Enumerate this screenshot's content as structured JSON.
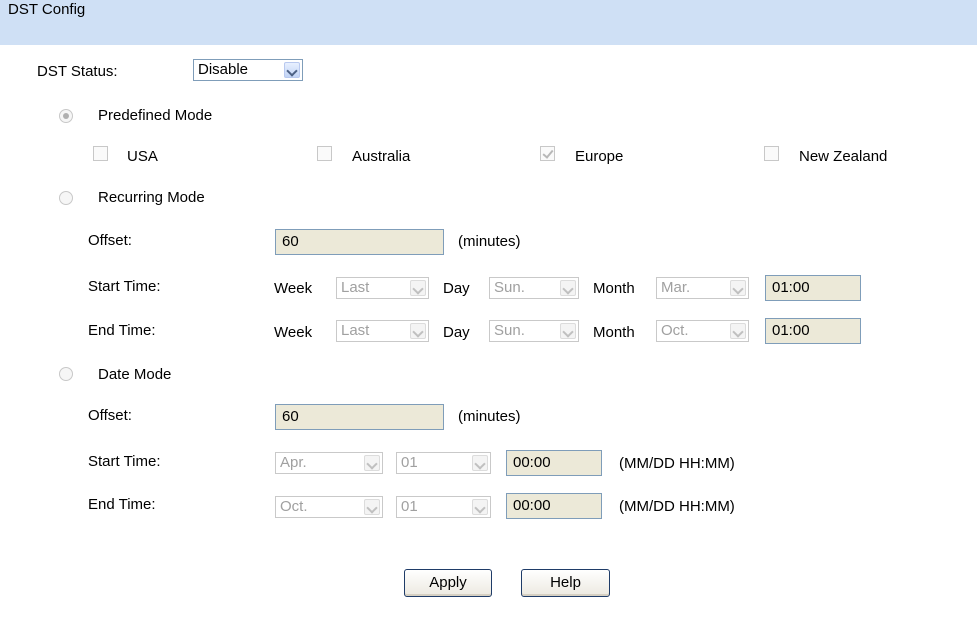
{
  "header": {
    "title": "DST Config"
  },
  "dst_status": {
    "label": "DST Status:",
    "value": "Disable"
  },
  "predefined": {
    "label": "Predefined Mode",
    "selected": true,
    "regions": [
      {
        "label": "USA",
        "checked": false
      },
      {
        "label": "Australia",
        "checked": false
      },
      {
        "label": "Europe",
        "checked": true
      },
      {
        "label": "New Zealand",
        "checked": false
      }
    ]
  },
  "recurring": {
    "label": "Recurring Mode",
    "offset_label": "Offset:",
    "offset_value": "60",
    "offset_unit": "(minutes)",
    "start_label": "Start Time:",
    "end_label": "End Time:",
    "week_label": "Week",
    "day_label": "Day",
    "month_label": "Month",
    "start": {
      "week": "Last",
      "day": "Sun.",
      "month": "Mar.",
      "time": "01:00"
    },
    "end": {
      "week": "Last",
      "day": "Sun.",
      "month": "Oct.",
      "time": "01:00"
    }
  },
  "date_mode": {
    "label": "Date Mode",
    "offset_label": "Offset:",
    "offset_value": "60",
    "offset_unit": "(minutes)",
    "start_label": "Start Time:",
    "end_label": "End Time:",
    "format_hint": "(MM/DD HH:MM)",
    "start": {
      "month": "Apr.",
      "day": "01",
      "time": "00:00"
    },
    "end": {
      "month": "Oct.",
      "day": "01",
      "time": "00:00"
    }
  },
  "buttons": {
    "apply": "Apply",
    "help": "Help"
  }
}
